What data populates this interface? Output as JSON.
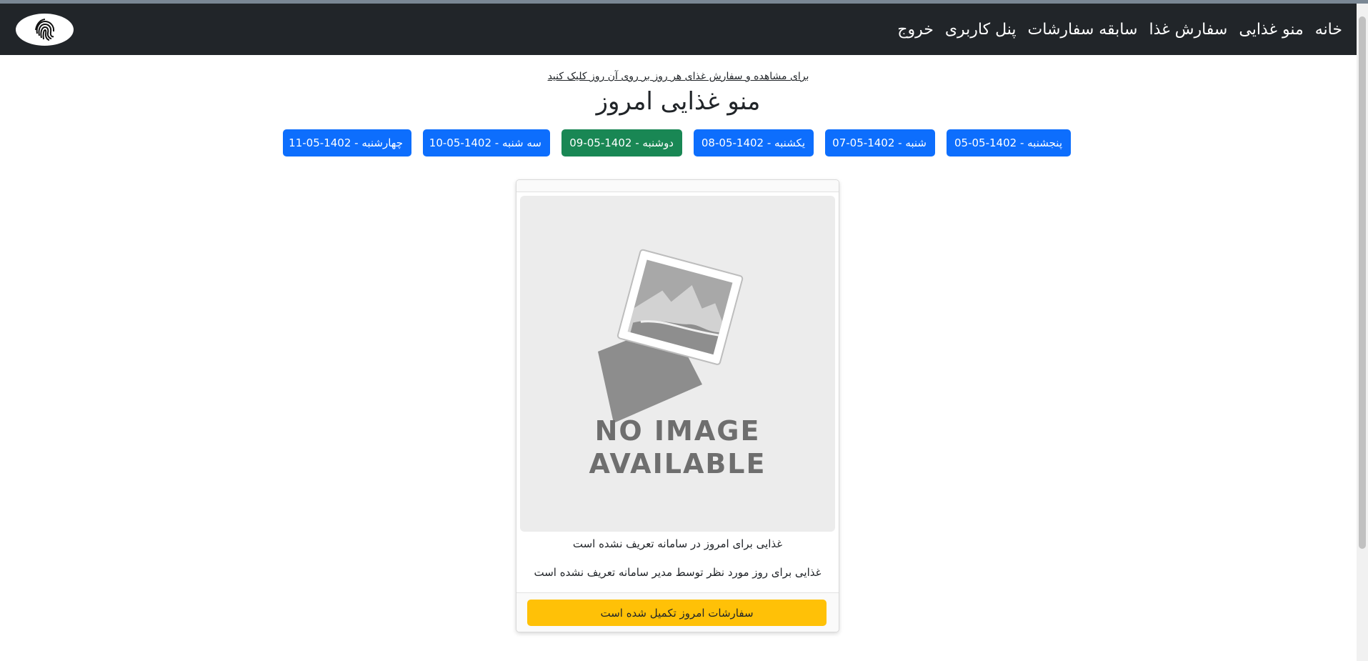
{
  "nav": {
    "links": [
      "خانه",
      "منو غذایی",
      "سفارش غذا",
      "سابقه سفارشات",
      "پنل کاربری",
      "خروج"
    ]
  },
  "hint": "برای مشاهده و سفارش غذای هر روز بر روی آن روز کلیک کنید",
  "title": "منو غذایی امروز",
  "days": [
    {
      "label": "پنجشنبه - 1402-05-05",
      "state": "default"
    },
    {
      "label": "شنبه - 1402-05-07",
      "state": "default"
    },
    {
      "label": "یکشنبه - 1402-05-08",
      "state": "default"
    },
    {
      "label": "دوشنبه - 1402-05-09",
      "state": "active"
    },
    {
      "label": "سه شنبه - 1402-05-10",
      "state": "default"
    },
    {
      "label": "چهارشنبه - 1402-05-11",
      "state": "default"
    }
  ],
  "card": {
    "image_placeholder": {
      "line1": "NO IMAGE",
      "line2": "AVAILABLE"
    },
    "text1": "غذایی برای امروز در سامانه تعریف نشده است",
    "text2": "غذایی برای روز مورد نظر توسط مدیر سامانه تعریف نشده است",
    "status_button": "سفارشات امروز تکمیل شده است"
  },
  "colors": {
    "navbar": "#212529",
    "primary": "#0d6efd",
    "success": "#198754",
    "warning": "#ffc107"
  }
}
